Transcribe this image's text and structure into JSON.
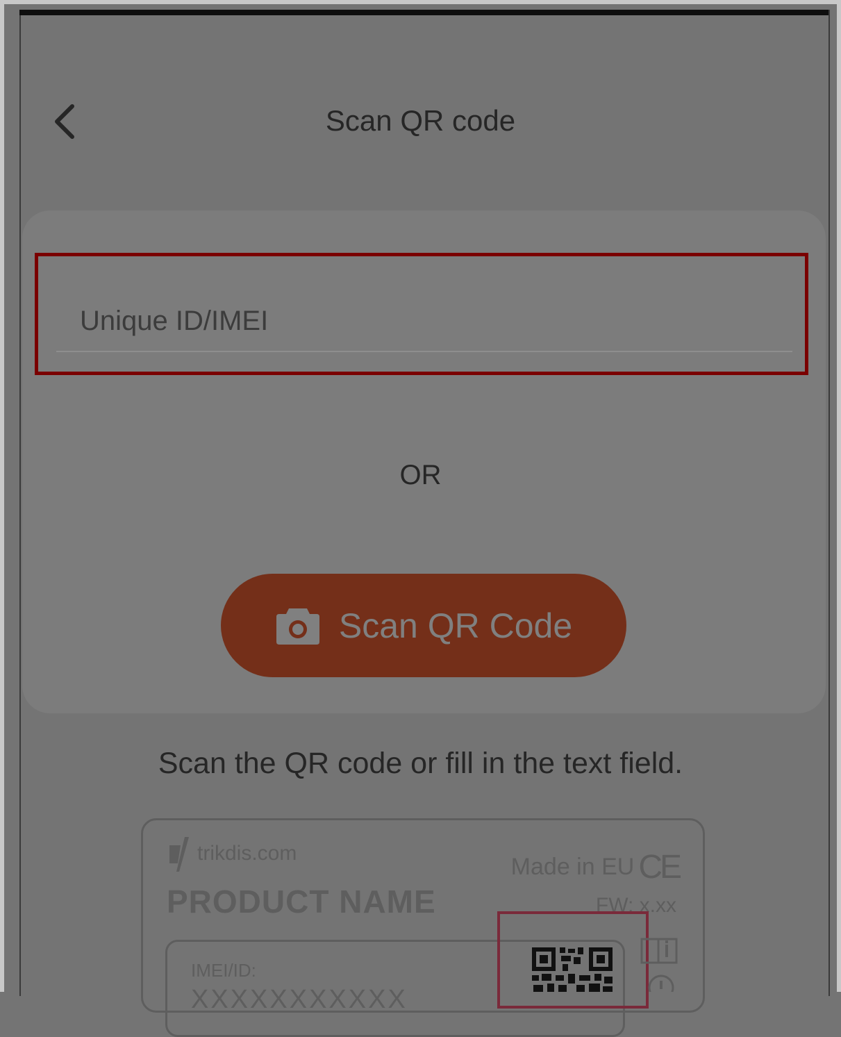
{
  "header": {
    "title": "Scan QR code",
    "back_icon": "chevron-left-icon"
  },
  "form": {
    "id_input_placeholder": "Unique ID/IMEI",
    "id_input_value": "",
    "or_label": "OR",
    "scan_button_label": "Scan QR Code",
    "scan_button_icon": "camera-icon"
  },
  "helper_text": "Scan the QR code or fill in the text field.",
  "label_illustration": {
    "brand": "trikdis.com",
    "product_name": "PRODUCT NAME",
    "made_in": "Made in EU",
    "ce_mark": "CE",
    "firmware": "FW: x.xx",
    "imei_label": "IMEI/ID:",
    "imei_value": "XXXXXXXXXXX"
  },
  "colors": {
    "highlight_border": "#7a0000",
    "scan_button": "#742f19",
    "overlay_background": "#747474"
  }
}
